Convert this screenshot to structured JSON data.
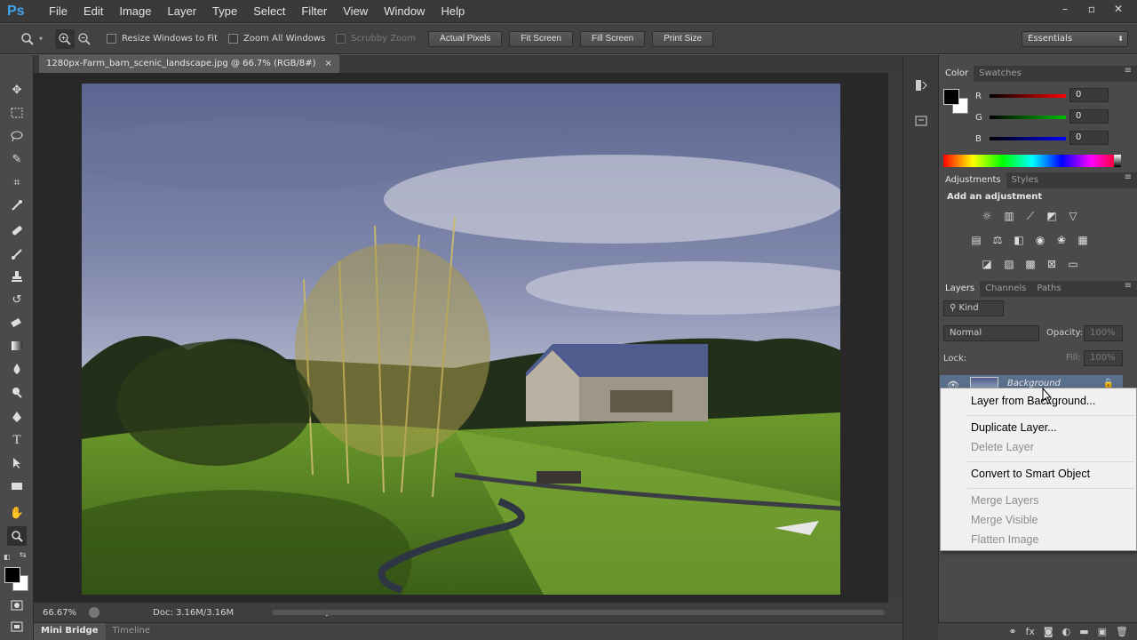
{
  "app": {
    "logo": "Ps"
  },
  "menu": [
    "File",
    "Edit",
    "Image",
    "Layer",
    "Type",
    "Select",
    "Filter",
    "View",
    "Window",
    "Help"
  ],
  "window_controls": [
    "–",
    "▫",
    "✕"
  ],
  "options": {
    "resize_windows": "Resize Windows to Fit",
    "zoom_all": "Zoom All Windows",
    "scrubby_zoom": "Scrubby Zoom",
    "actual_pixels": "Actual Pixels",
    "fit_screen": "Fit Screen",
    "fill_screen": "Fill Screen",
    "print_size": "Print Size",
    "workspace": "Essentials"
  },
  "document": {
    "tab_title": "1280px-Farm_barn_scenic_landscape.jpg @ 66.7% (RGB/8#)",
    "close": "×"
  },
  "status": {
    "zoom": "66.67%",
    "doc": "Doc: 3.16M/3.16M"
  },
  "bottom_tabs": [
    "Mini Bridge",
    "Timeline"
  ],
  "color_panel": {
    "tabs": [
      "Color",
      "Swatches"
    ],
    "channels": [
      {
        "label": "R",
        "value": "0",
        "color": "#ff0000"
      },
      {
        "label": "G",
        "value": "0",
        "color": "#00c000"
      },
      {
        "label": "B",
        "value": "0",
        "color": "#0000ff"
      }
    ]
  },
  "adjustments_panel": {
    "tabs": [
      "Adjustments",
      "Styles"
    ],
    "title": "Add an adjustment"
  },
  "layers_panel": {
    "tabs": [
      "Layers",
      "Channels",
      "Paths"
    ],
    "kind": "Kind",
    "blend_mode": "Normal",
    "opacity_label": "Opacity:",
    "opacity_value": "100%",
    "lock_label": "Lock:",
    "fill_label": "Fill:",
    "fill_value": "100%",
    "layer_name": "Background"
  },
  "context_menu": {
    "layer_from_background": "Layer from Background...",
    "duplicate_layer": "Duplicate Layer...",
    "delete_layer": "Delete Layer",
    "convert_smart": "Convert to Smart Object",
    "merge_layers": "Merge Layers",
    "merge_visible": "Merge Visible",
    "flatten_image": "Flatten Image"
  }
}
